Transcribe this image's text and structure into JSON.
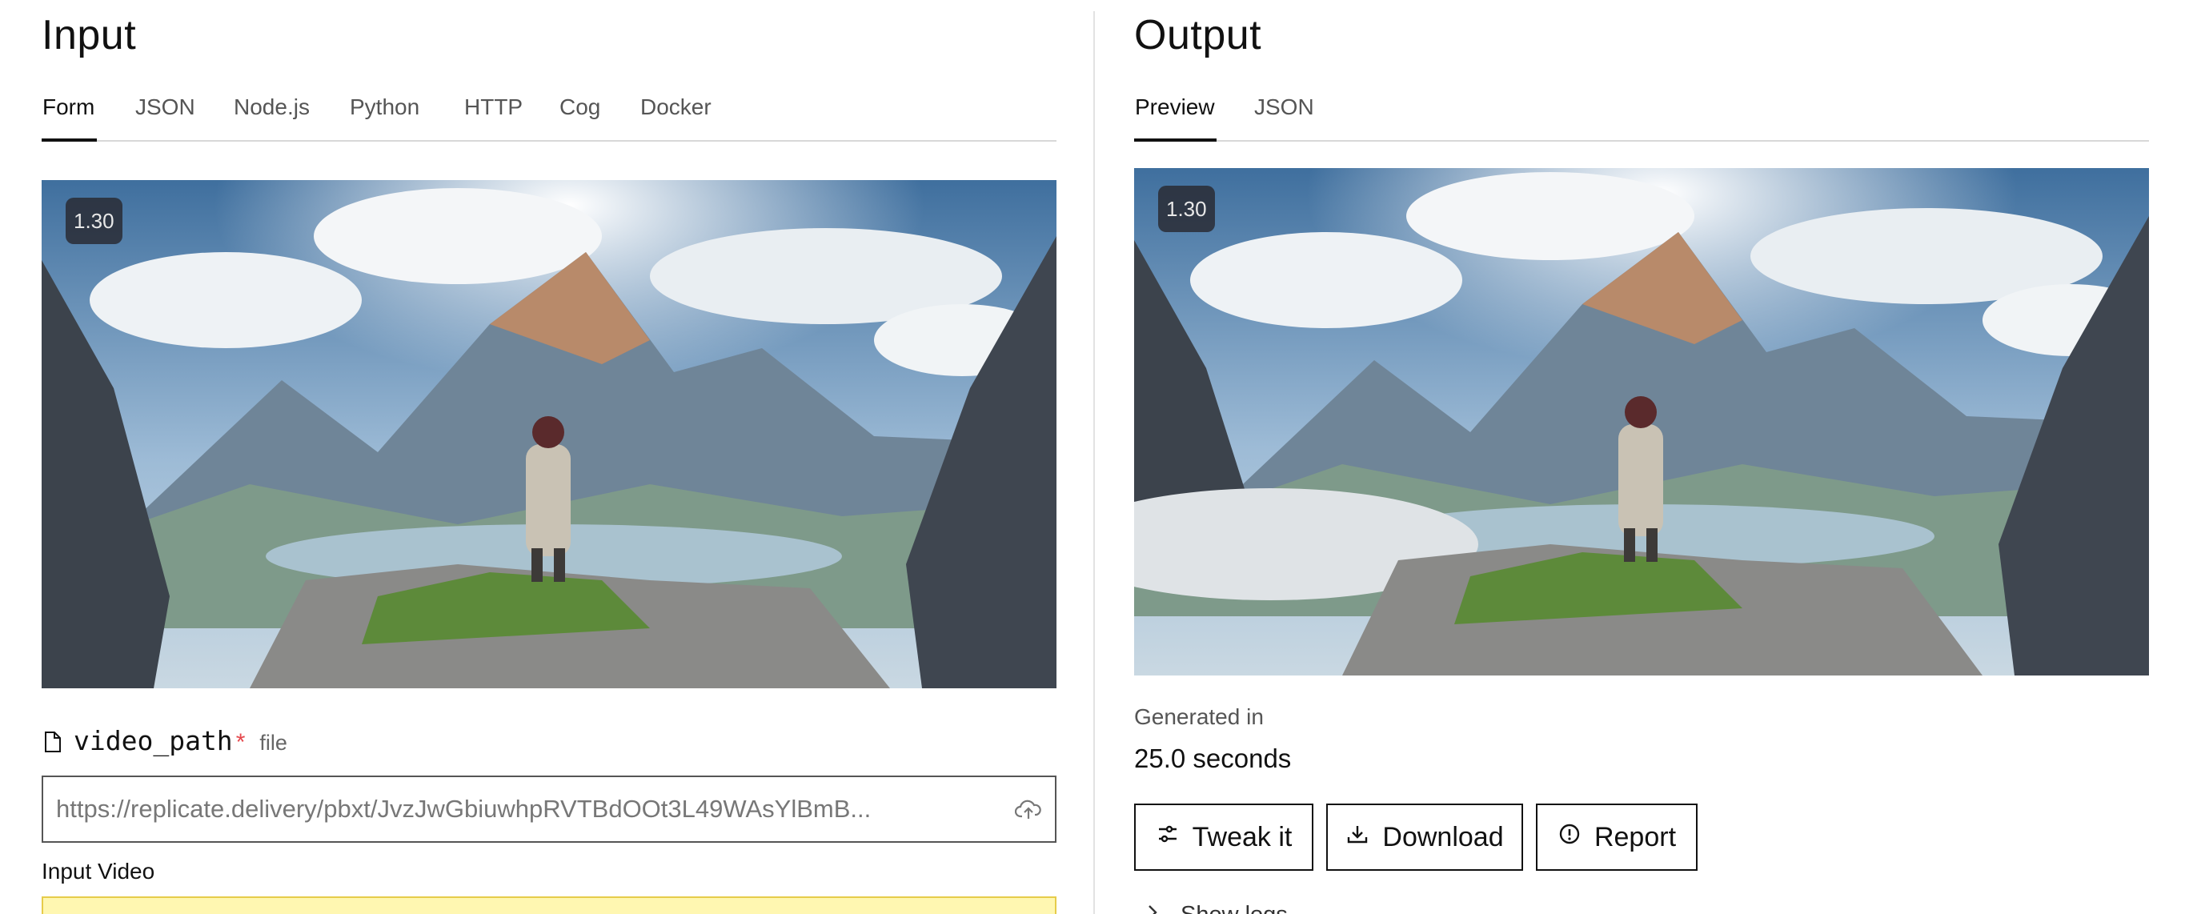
{
  "input": {
    "title": "Input",
    "tabs": [
      {
        "label": "Form",
        "active": true
      },
      {
        "label": "JSON",
        "active": false
      },
      {
        "label": "Node.js",
        "active": false
      },
      {
        "label": "Python",
        "active": false
      },
      {
        "label": "HTTP",
        "active": false
      },
      {
        "label": "Cog",
        "active": false
      },
      {
        "label": "Docker",
        "active": false
      }
    ],
    "preview_badge": "1.30",
    "field": {
      "name": "video_path",
      "required_mark": "*",
      "type": "file",
      "value": "https://replicate.delivery/pbxt/JvzJwGbiuwhpRVTBdOOt3L49WAsYlBmB...",
      "label": "Input Video"
    }
  },
  "output": {
    "title": "Output",
    "tabs": [
      {
        "label": "Preview",
        "active": true
      },
      {
        "label": "JSON",
        "active": false
      }
    ],
    "preview_badge": "1.30",
    "generated_label": "Generated in",
    "generated_value": "25.0 seconds",
    "buttons": {
      "tweak": "Tweak it",
      "download": "Download",
      "report": "Report"
    },
    "show_logs": "Show logs"
  },
  "icons": {
    "file": "file-icon",
    "upload": "cloud-upload-icon",
    "tweak": "sliders-icon",
    "download": "download-icon",
    "report": "alert-circle-icon",
    "chevron": "chevron-right-icon"
  },
  "colors": {
    "accent": "#111111",
    "required": "#e5484d",
    "highlight": "#fff7b1"
  }
}
